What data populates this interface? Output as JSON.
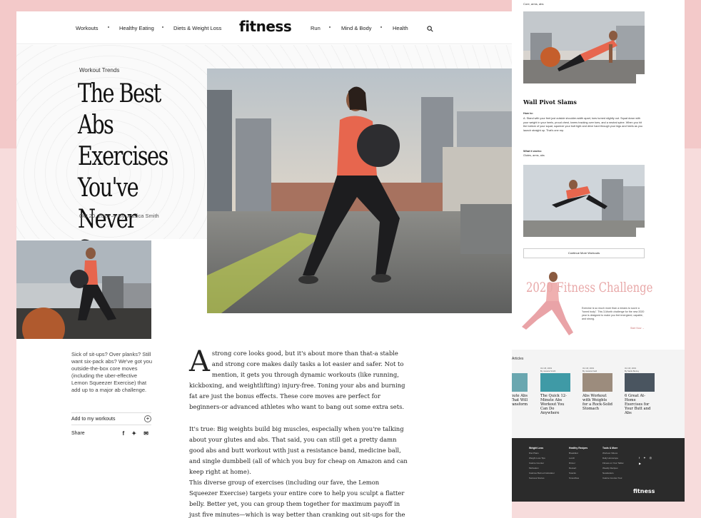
{
  "nav": {
    "items_left": [
      "Workouts",
      "Healthy Eating",
      "Diets & Weight Loss"
    ],
    "logo": "fitness",
    "items_right": [
      "Run",
      "Mind & Body",
      "Health"
    ]
  },
  "article": {
    "category": "Workout Trends",
    "headline": "The Best Abs Exercises You've Never Seen Before",
    "byline": "Oct  20, 2019 — By Jessica Smith",
    "dropcap": "A",
    "paragraphs": [
      "strong core looks good, but it's about more than that-a stable and strong core makes daily tasks a lot easier and safer. Not to mention, it gets you through dynamic workouts (like running, kickboxing, and weightlifting) injury-free. Toning your abs and burning fat are just the bonus effects. These core moves are perfect for beginners-or advanced athletes who want to bang out some extra sets.",
      "It's true: Big weights build big muscles, especially when you're talking about your glutes and abs. That said, you can still get a pretty damn good abs and butt workout with just a resistance band, medicine ball, and single dumbbell (all of which you buy for cheap on Amazon and can keep right at home).",
      "This diverse group of exercises (including our fave, the Lemon Squeezer Exercise) targets your entire core to help you sculpt a flatter belly. Better yet, you can group them together for maximum payoff in just five minutes—which is way better than cranking out sit-ups for the same amount of time. Just"
    ]
  },
  "sidebar": {
    "promo": "Sick of sit-ups? Over planks? Still want six-pack abs? We've got you outside-the-box core moves (including the uber-effective Lemon Squeezer Exercise) that add up to a major ab challenge.",
    "add_label": "Add to my workouts",
    "add_icon": "+",
    "share_label": "Share",
    "share_icons": "f ✦ ✉"
  },
  "right": {
    "top_works": "Core, arms, abs",
    "section_title": "Wall Pivot Slams",
    "how_to_label": "How to:",
    "how_to_text": "A. Stand with your feet just outside shoulder-width apart, toes turned slightly out. Squat down with your weight in your heels, proud chest, knees tracking over toes, and a neutral spine. When you hit the bottom of your squat, squeeze your butt tight and drive hard through your legs and heels as you launch straight up. That's one rep.",
    "what_works_label": "What it works:",
    "what_works_text": "Glutes, arms, abs",
    "continue_btn": "Continue More Workouts",
    "challenge_title": "2020 Fitness Challenge",
    "challenge_text": "Exercise is so much more than a means to score a \"toned body\". This 3-Month challenge for the new 2020 year is designed to make you feel energized, capable, and strong.",
    "challenge_link": "Start Now →",
    "articles_label": "Articles",
    "articles": [
      {
        "date": "",
        "by": "",
        "title": "Minute Abs That Will Transform"
      },
      {
        "date": "Oct 18, 2019",
        "by": "By Jessica Smith",
        "title": "The Quick 12-Minute Abs Workout You Can Do Anywhere"
      },
      {
        "date": "Oct 18, 2019",
        "by": "By Jessica Field",
        "title": "Abs Workout with Weights for a Rock-Solid Stomach"
      },
      {
        "date": "Oct 18, 2019",
        "by": "By Stella Bexley",
        "title": "6 Great At-Home Exercises for Your Butt and Abs"
      }
    ],
    "footer_cols": [
      {
        "head": "Weight Loss",
        "items": [
          "Diet Plans",
          "Weight Loss Tips",
          "Calorie Counter",
          "Motivation",
          "Calories Burned Calculator",
          "Success Stories"
        ]
      },
      {
        "head": "Healthy Recipes",
        "items": [
          "Breakfast",
          "Lunch",
          "Dinner",
          "Dessert",
          "Snacks",
          "Smoothies"
        ]
      },
      {
        "head": "Tools & More",
        "items": [
          "Workout Videos",
          "Daily Horoscope",
          "Fitness on Your Tablet",
          "Weekly Recipes",
          "Newsletters",
          "Calorie Counter Tool"
        ]
      }
    ],
    "footer_social": "f ✦ ◎ ▶",
    "footer_logo": "fitness"
  }
}
